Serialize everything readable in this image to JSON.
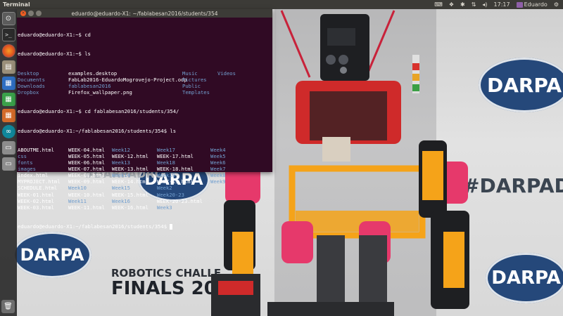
{
  "panel": {
    "title": "Terminal",
    "clock": "17:17",
    "user": "Eduardo"
  },
  "window": {
    "title": "eduardo@eduardo-X1: ~/fablabesan2016/students/354"
  },
  "terminal": {
    "lines": [
      "eduardo@eduardo-X1:~$ cd",
      "eduardo@eduardo-X1:~$ ls"
    ],
    "home_ls": [
      [
        {
          "t": "Desktop",
          "k": "dir"
        },
        {
          "t": "examples.desktop",
          "k": "file"
        },
        {
          "t": "Music",
          "k": "dir"
        },
        {
          "t": "Videos",
          "k": "dir"
        }
      ],
      [
        {
          "t": "Documents",
          "k": "dir"
        },
        {
          "t": "FabLab2016-EduardoMogrovejo-Project.odp",
          "k": "file"
        },
        {
          "t": "Pictures",
          "k": "dir"
        },
        {
          "t": "",
          "k": "file"
        }
      ],
      [
        {
          "t": "Downloads",
          "k": "dir"
        },
        {
          "t": "fablabesan2016",
          "k": "dir"
        },
        {
          "t": "Public",
          "k": "dir"
        },
        {
          "t": "",
          "k": "file"
        }
      ],
      [
        {
          "t": "Dropbox",
          "k": "dir"
        },
        {
          "t": "Firefox_wallpaper.png",
          "k": "file"
        },
        {
          "t": "Templates",
          "k": "dir"
        },
        {
          "t": "",
          "k": "file"
        }
      ]
    ],
    "cd_line": "eduardo@eduardo-X1:~$ cd fablabesan2016/students/354/",
    "ls_line": "eduardo@eduardo-X1:~/fablabesan2016/students/354$ ls",
    "dir_ls": [
      [
        {
          "t": "ABOUTME.html",
          "k": "file"
        },
        {
          "t": "WEEK-04.html",
          "k": "file"
        },
        {
          "t": "Week12",
          "k": "dir"
        },
        {
          "t": "Week17",
          "k": "dir"
        },
        {
          "t": "Week4",
          "k": "dir"
        }
      ],
      [
        {
          "t": "css",
          "k": "dir"
        },
        {
          "t": "WEEK-05.html",
          "k": "file"
        },
        {
          "t": "WEEK-12.html",
          "k": "file"
        },
        {
          "t": "WEEK-17.html",
          "k": "file"
        },
        {
          "t": "Week5",
          "k": "dir"
        }
      ],
      [
        {
          "t": "fonts",
          "k": "dir"
        },
        {
          "t": "WEEK-06.html",
          "k": "file"
        },
        {
          "t": "Week13",
          "k": "dir"
        },
        {
          "t": "Week18",
          "k": "dir"
        },
        {
          "t": "Week6",
          "k": "dir"
        }
      ],
      [
        {
          "t": "images",
          "k": "dir"
        },
        {
          "t": "WEEK-07.html",
          "k": "file"
        },
        {
          "t": "WEEK-13.html",
          "k": "file"
        },
        {
          "t": "WEEK-18.html",
          "k": "file"
        },
        {
          "t": "Week7",
          "k": "dir"
        }
      ],
      [
        {
          "t": "index.html",
          "k": "file"
        },
        {
          "t": "WEEK-08.html",
          "k": "file"
        },
        {
          "t": "Week14",
          "k": "dir"
        },
        {
          "t": "Week19",
          "k": "dir"
        },
        {
          "t": "Week8",
          "k": "dir"
        }
      ],
      [
        {
          "t": "MYPROJECT.html",
          "k": "file"
        },
        {
          "t": "WEEK-09.html",
          "k": "file"
        },
        {
          "t": "WEEK-14.html",
          "k": "file"
        },
        {
          "t": "WEEK-19.html",
          "k": "file"
        },
        {
          "t": "Week9",
          "k": "dir"
        }
      ],
      [
        {
          "t": "SCHEDULE.html",
          "k": "file"
        },
        {
          "t": "Week10",
          "k": "dir"
        },
        {
          "t": "Week15",
          "k": "dir"
        },
        {
          "t": "Week2",
          "k": "dir"
        },
        {
          "t": "",
          "k": "file"
        }
      ],
      [
        {
          "t": "WEEK-01.html",
          "k": "file"
        },
        {
          "t": "WEEK-10.html",
          "k": "file"
        },
        {
          "t": "WEEK-15.html",
          "k": "file"
        },
        {
          "t": "Week20-23",
          "k": "dir"
        },
        {
          "t": "",
          "k": "file"
        }
      ],
      [
        {
          "t": "WEEK-02.html",
          "k": "file"
        },
        {
          "t": "Week11",
          "k": "dir"
        },
        {
          "t": "Week16",
          "k": "dir"
        },
        {
          "t": "WEEK-20-23.html",
          "k": "file"
        },
        {
          "t": "",
          "k": "file"
        }
      ],
      [
        {
          "t": "WEEK-03.html",
          "k": "file"
        },
        {
          "t": "WEEK-11.html",
          "k": "file"
        },
        {
          "t": "WEEK-16.html",
          "k": "file"
        },
        {
          "t": "Week3",
          "k": "dir"
        },
        {
          "t": "",
          "k": "file"
        }
      ]
    ],
    "final_prompt": "eduardo@eduardo-X1:~/fablabesan2016/students/354$ "
  },
  "wallpaper": {
    "logo_text": "DARPA",
    "hashtag": "#DARPADRC",
    "banner_line1": "ROBOTICS CHALLE",
    "banner_line2": "FINALS 20",
    "faint_hashtag": "#DARPADRC"
  },
  "launcher": {
    "icons": [
      "dash-icon",
      "terminal-icon",
      "firefox-icon",
      "files-icon",
      "libreoffice-writer-icon",
      "libreoffice-calc-icon",
      "libreoffice-impress-icon",
      "arduino-icon",
      "drive-icon",
      "drive-icon-2",
      "trash-icon"
    ]
  },
  "colors": {
    "terminal_bg": "#300a24",
    "dir_color": "#729fcf",
    "panel_bg": "#3c3b37",
    "darpa_blue": "#25487a"
  }
}
